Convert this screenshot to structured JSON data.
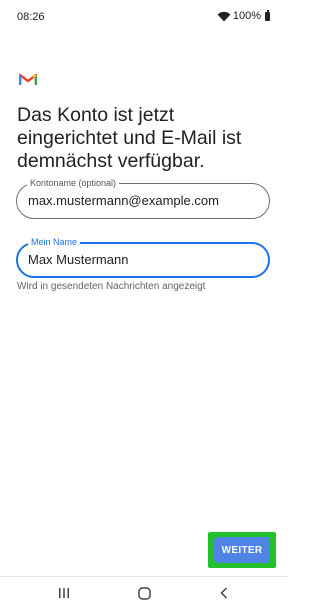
{
  "status_bar": {
    "time": "08:26",
    "battery": "100%"
  },
  "headline": "Das Konto ist jetzt eingerichtet und E-Mail ist demnächst verfügbar.",
  "account_field": {
    "label": "Kontoname (optional)",
    "value": "max.mustermann@example.com"
  },
  "name_field": {
    "label": "Mein Name",
    "value": "Max Mustermann"
  },
  "helper_text": "Wird in gesendeten Nachrichten angezeigt",
  "next_button": {
    "label": "WEITER"
  },
  "colors": {
    "accent": "#1a73e8",
    "button": "#5083e6",
    "highlight": "#22c02a"
  },
  "icons": [
    "wifi-icon",
    "battery-icon",
    "gmail-logo",
    "recents-icon",
    "home-icon",
    "back-icon"
  ]
}
